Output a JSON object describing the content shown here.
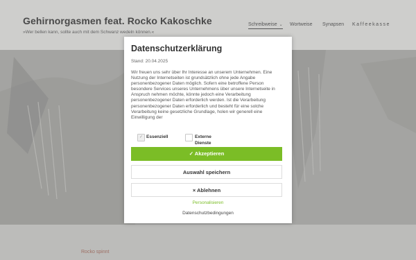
{
  "site": {
    "title": "Gehirnorgasmen feat. Rocko Kakoschke",
    "tagline": "»Wer bellen kann, sollte auch mit dem Schwanz wedeln können.«"
  },
  "nav": {
    "items": [
      {
        "label": "Schreibweise",
        "active": true,
        "has_dropdown": true
      },
      {
        "label": "Wortweise",
        "active": false
      },
      {
        "label": "Synapsen",
        "active": false
      },
      {
        "label": "Kaffeekasse",
        "active": false
      }
    ],
    "dropdown_icon": "chevron-down-icon"
  },
  "page": {
    "bottom_link": "Rocko spinnt"
  },
  "consent": {
    "title": "Datenschutzerklärung",
    "date": "Stand: 20.04.2025",
    "body": "Wir freuen uns sehr über Ihr Interesse an unserem Unternehmen. Eine Nutzung der Internetseiten ist grundsätzlich ohne jede Angabe personenbezogener Daten möglich. Sofern eine betroffene Person besondere Services unseres Unternehmens über unsere Internetseite in Anspruch nehmen möchte, könnte jedoch eine Verarbeitung personenbezogener Daten erforderlich werden. Ist die Verarbeitung personenbezogener Daten erforderlich und besteht für eine solche Verarbeitung keine gesetzliche Grundlage, holen wir generell eine Einwilligung der",
    "checkboxes": [
      {
        "label": "Essenziell",
        "checked": true,
        "disabled": true
      },
      {
        "label": "Externe Dienste",
        "checked": false,
        "disabled": false
      }
    ],
    "accept_label": "✓ Akzeptieren",
    "save_label": "Auswahl speichern",
    "reject_label": "× Ablehnen",
    "personalize_label": "Personalisieren",
    "privacy_link_label": "Datenschutzbedingungen",
    "colors": {
      "accent": "#7bbd26"
    }
  }
}
